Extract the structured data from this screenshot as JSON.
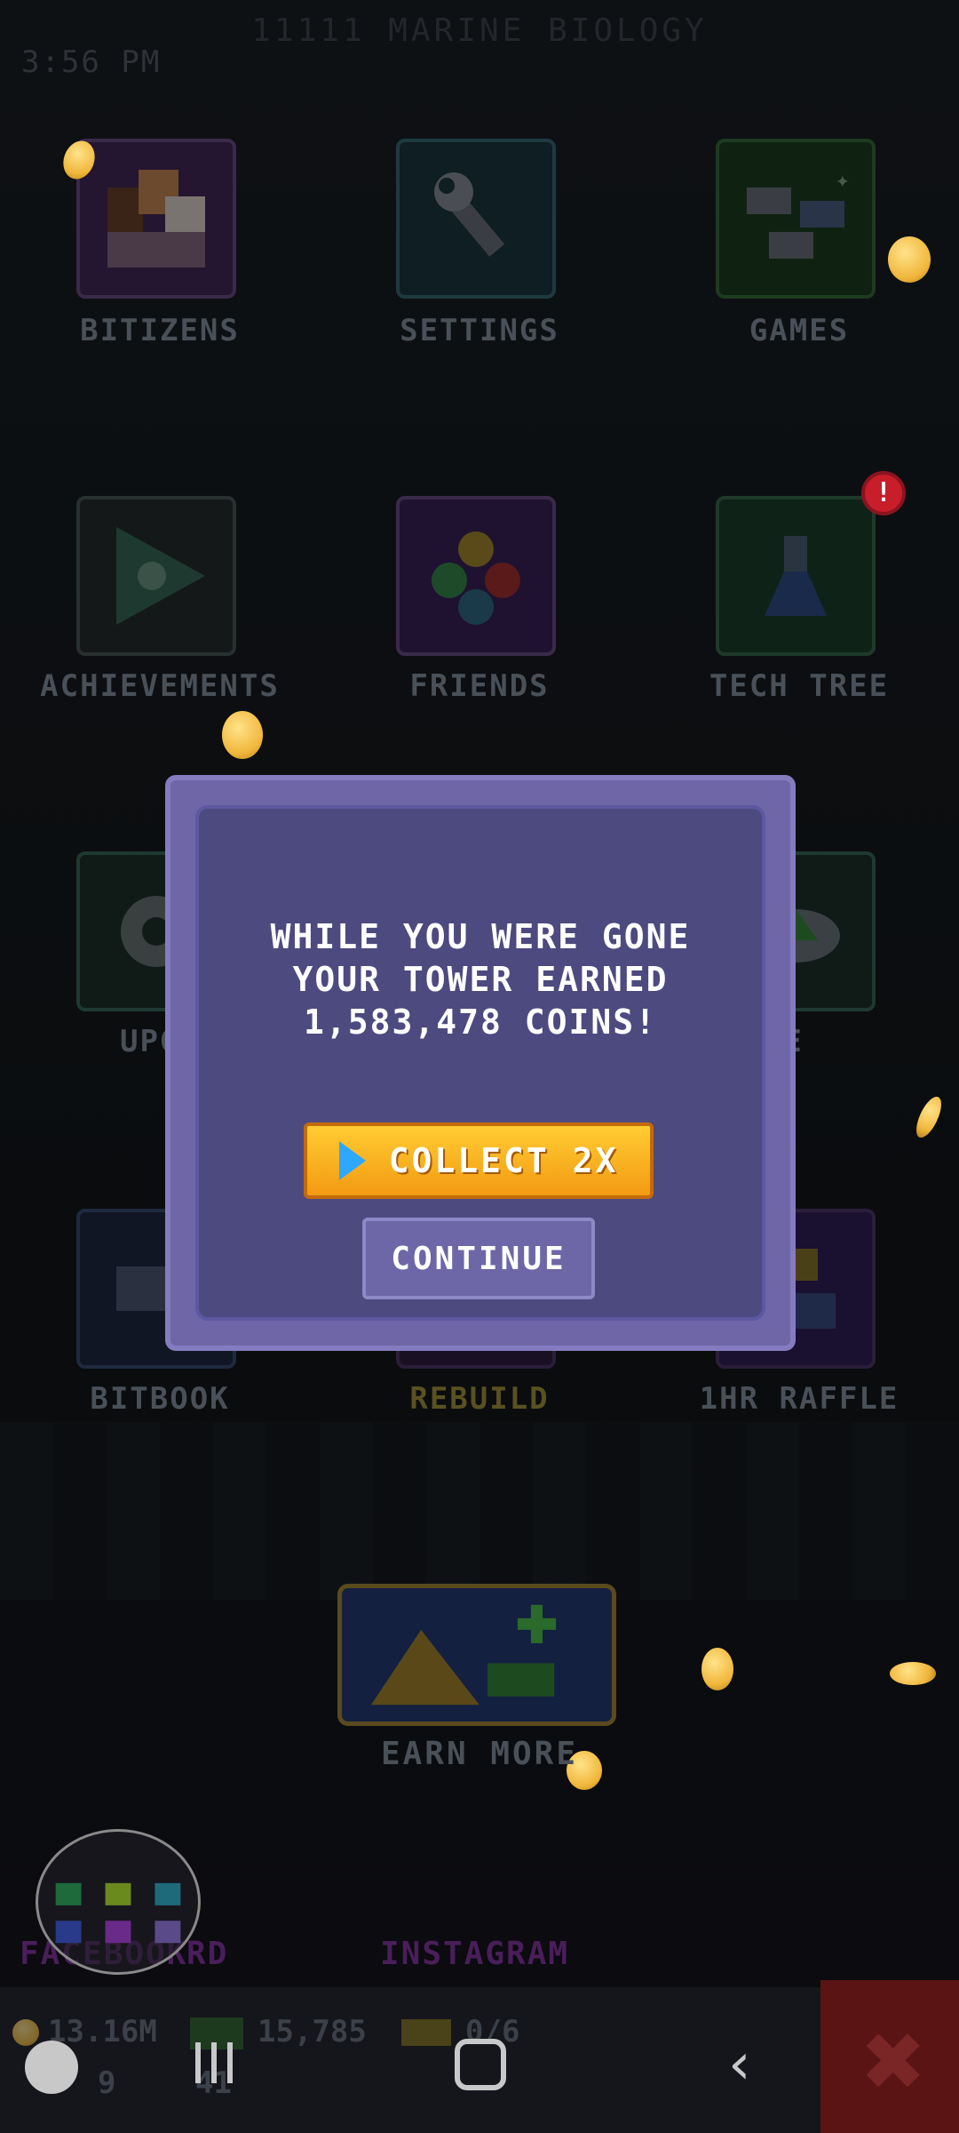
{
  "status_bar": {
    "time": "3:56 PM"
  },
  "floor_title": "11111 MARINE BIOLOGY",
  "menu": {
    "row1": [
      {
        "label": "BITIZENS",
        "icon": "bitizens-icon"
      },
      {
        "label": "SETTINGS",
        "icon": "wrench-icon"
      },
      {
        "label": "GAMES",
        "icon": "games-icon"
      }
    ],
    "row2": [
      {
        "label": "ACHIEVEMENTS",
        "icon": "play-triangle-icon"
      },
      {
        "label": "FRIENDS",
        "icon": "friends-icon"
      },
      {
        "label": "TECH TREE",
        "icon": "flask-icon",
        "badge": "!"
      }
    ],
    "row3": [
      {
        "label": "UPGR",
        "icon": "gear-icon"
      },
      {
        "label": "D SAVE",
        "icon": "cloud-save-icon"
      }
    ],
    "row4": [
      {
        "label": "BITBOOK",
        "icon": "bitbook-icon"
      },
      {
        "label": "REBUILD",
        "icon": "rebuild-icon"
      },
      {
        "label": "1HR RAFFLE",
        "icon": "raffle-icon"
      }
    ]
  },
  "modal": {
    "message": "WHILE YOU WERE GONE YOUR TOWER EARNED 1,583,478 COINS!",
    "collect_label": "COLLECT 2X",
    "continue_label": "CONTINUE"
  },
  "earn_more": {
    "label": "EARN MORE"
  },
  "links": {
    "facebook": "FACEBOOK",
    "discord": "RD",
    "instagram": "INSTAGRAM"
  },
  "hud": {
    "coins": "13.16M",
    "bux": "15,785",
    "tickets": "0/6",
    "level": "9",
    "extra": "41"
  },
  "colors": {
    "modal_bg": "#4d4a80",
    "modal_border": "#6f66a8",
    "collect_button": "#f6a91c",
    "continue_button": "#6d67a8",
    "accent_play": "#2ea8ff"
  }
}
